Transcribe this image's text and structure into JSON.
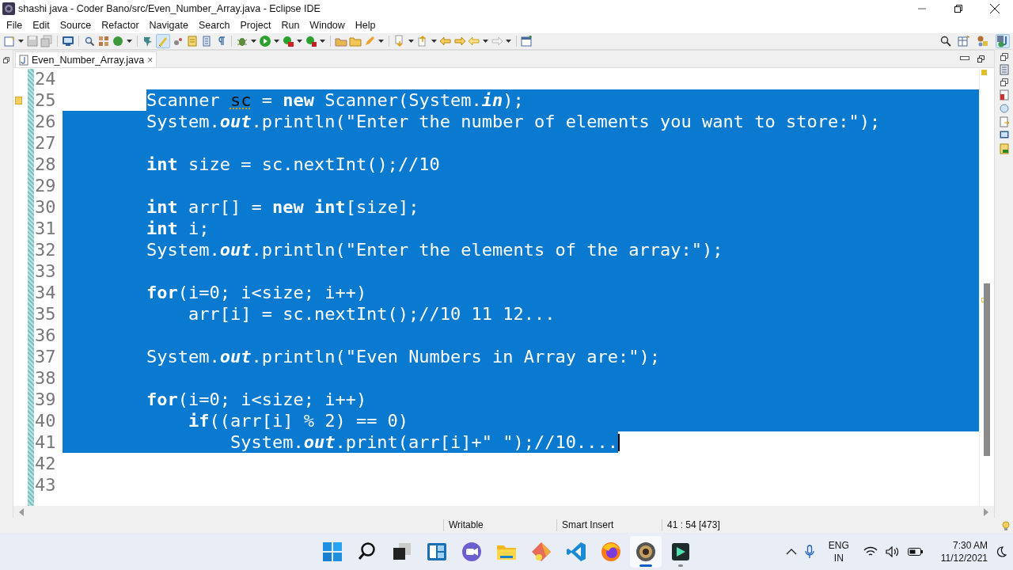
{
  "window": {
    "title": "shashi java - Coder Bano/src/Even_Number_Array.java - Eclipse IDE"
  },
  "menu": [
    "File",
    "Edit",
    "Source",
    "Refactor",
    "Navigate",
    "Search",
    "Project",
    "Run",
    "Window",
    "Help"
  ],
  "editor_tab": {
    "label": "Even_Number_Array.java",
    "close": "×",
    "selected": true
  },
  "lines": [
    {
      "number": "24",
      "selected": false
    },
    {
      "number": "25",
      "selected": true,
      "warning": true,
      "tokens": [
        {
          "kind": "plain",
          "text": "        Scanner "
        },
        {
          "kind": "warning",
          "text": "sc"
        },
        {
          "kind": "plain",
          "text": " = "
        },
        {
          "kind": "keyword",
          "text": "new"
        },
        {
          "kind": "plain",
          "text": " Scanner(System."
        },
        {
          "kind": "static",
          "text": "in"
        },
        {
          "kind": "plain",
          "text": ");"
        }
      ]
    },
    {
      "number": "26",
      "selected": true,
      "tokens": [
        {
          "kind": "plain",
          "text": "        System."
        },
        {
          "kind": "static",
          "text": "out"
        },
        {
          "kind": "plain",
          "text": ".println("
        },
        {
          "kind": "string",
          "text": "\"Enter the number of elements you want to store:\""
        },
        {
          "kind": "plain",
          "text": ");"
        }
      ]
    },
    {
      "number": "27",
      "selected": true
    },
    {
      "number": "28",
      "selected": true,
      "tokens": [
        {
          "kind": "keyword",
          "text": "        int"
        },
        {
          "kind": "plain",
          "text": " size = sc.nextInt();"
        },
        {
          "kind": "comment",
          "text": "//10"
        }
      ]
    },
    {
      "number": "29",
      "selected": true
    },
    {
      "number": "30",
      "selected": true,
      "tokens": [
        {
          "kind": "keyword",
          "text": "        int"
        },
        {
          "kind": "plain",
          "text": " arr[] = "
        },
        {
          "kind": "keyword",
          "text": "new int"
        },
        {
          "kind": "plain",
          "text": "[size];"
        }
      ]
    },
    {
      "number": "31",
      "selected": true,
      "tokens": [
        {
          "kind": "keyword",
          "text": "        int"
        },
        {
          "kind": "plain",
          "text": " i;"
        }
      ]
    },
    {
      "number": "32",
      "selected": true,
      "tokens": [
        {
          "kind": "plain",
          "text": "        System."
        },
        {
          "kind": "static",
          "text": "out"
        },
        {
          "kind": "plain",
          "text": ".println("
        },
        {
          "kind": "string",
          "text": "\"Enter the elements of the array:\""
        },
        {
          "kind": "plain",
          "text": ");"
        }
      ]
    },
    {
      "number": "33",
      "selected": true
    },
    {
      "number": "34",
      "selected": true,
      "tokens": [
        {
          "kind": "keyword",
          "text": "        for"
        },
        {
          "kind": "plain",
          "text": "(i=0; i<size; i++)"
        }
      ]
    },
    {
      "number": "35",
      "selected": true,
      "tokens": [
        {
          "kind": "plain",
          "text": "            arr[i] = sc.nextInt();"
        },
        {
          "kind": "comment",
          "text": "//10 11 12..."
        }
      ]
    },
    {
      "number": "36",
      "selected": true
    },
    {
      "number": "37",
      "selected": true,
      "tokens": [
        {
          "kind": "plain",
          "text": "        System."
        },
        {
          "kind": "static",
          "text": "out"
        },
        {
          "kind": "plain",
          "text": ".println("
        },
        {
          "kind": "string",
          "text": "\"Even Numbers in Array are:\""
        },
        {
          "kind": "plain",
          "text": ");"
        }
      ]
    },
    {
      "number": "38",
      "selected": true
    },
    {
      "number": "39",
      "selected": true,
      "tokens": [
        {
          "kind": "keyword",
          "text": "        for"
        },
        {
          "kind": "plain",
          "text": "(i=0; i<size; i++)"
        }
      ]
    },
    {
      "number": "40",
      "selected": true,
      "tokens": [
        {
          "kind": "keyword",
          "text": "            if"
        },
        {
          "kind": "plain",
          "text": "((arr[i] % 2) == 0)"
        }
      ]
    },
    {
      "number": "41",
      "selected": true,
      "cursor": true,
      "tokens": [
        {
          "kind": "plain",
          "text": "                System."
        },
        {
          "kind": "static",
          "text": "out"
        },
        {
          "kind": "plain",
          "text": ".print(arr[i]+"
        },
        {
          "kind": "string",
          "text": "\" \""
        },
        {
          "kind": "plain",
          "text": ");"
        },
        {
          "kind": "comment",
          "text": "//10...."
        }
      ]
    },
    {
      "number": "42",
      "selected": false
    },
    {
      "number": "43",
      "selected": false
    }
  ],
  "status_bar": {
    "mode": "Writable",
    "insert": "Smart Insert",
    "position": "41 : 54 [473]"
  },
  "taskbar": {
    "apps": [
      {
        "kind": "start",
        "selected": false,
        "running": false
      },
      {
        "kind": "search",
        "selected": false,
        "running": false
      },
      {
        "kind": "taskview",
        "selected": false,
        "running": false
      },
      {
        "kind": "widgets",
        "selected": false,
        "running": false
      },
      {
        "kind": "chat",
        "selected": false,
        "running": false
      },
      {
        "kind": "folder",
        "selected": false,
        "running": false
      },
      {
        "kind": "git",
        "selected": false,
        "running": false
      },
      {
        "kind": "code",
        "selected": false,
        "running": false
      },
      {
        "kind": "browser",
        "selected": false,
        "running": false
      },
      {
        "kind": "gear",
        "selected": true,
        "running": true
      },
      {
        "kind": "film",
        "selected": false,
        "running": true
      }
    ],
    "language": "ENG",
    "region": "IN",
    "time": "7:30 AM",
    "date": "11/12/2021"
  }
}
